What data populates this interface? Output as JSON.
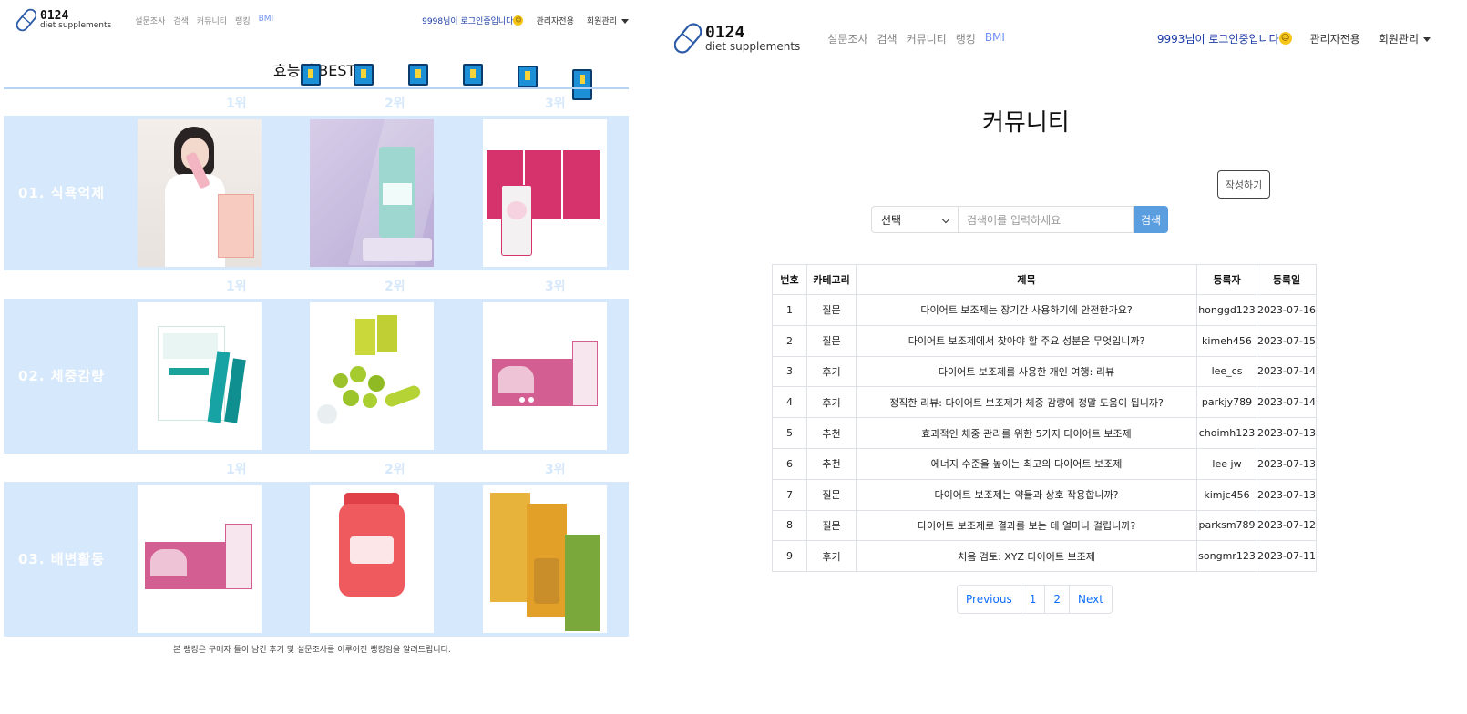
{
  "left": {
    "logo": {
      "number": "0124",
      "subtitle": "diet supplements"
    },
    "nav_links": [
      "설문조사",
      "검색",
      "커뮤니티",
      "랭킹",
      "BMI"
    ],
    "greeting": "9998님이 로그인중입니다",
    "admin_button": "관리자전용",
    "member_menu": "회원관리",
    "ranking_title": "효능별 BEST 3",
    "rank_labels": [
      "1위",
      "2위",
      "3위"
    ],
    "categories": [
      "01. 식욕억제",
      "02. 체중감량",
      "03. 배변활동"
    ],
    "footnote": "본 랭킹은 구매자 들이 남긴 후기 및 설문조사를 이루어진 랭킹임을 알려드립니다."
  },
  "right": {
    "logo": {
      "number": "0124",
      "subtitle": "diet supplements"
    },
    "nav_links": [
      "설문조사",
      "검색",
      "커뮤니티",
      "랭킹",
      "BMI"
    ],
    "greeting": "9993님이 로그인중입니다",
    "admin_button": "관리자전용",
    "member_menu": "회원관리",
    "page_title": "커뮤니티",
    "write_button": "작성하기",
    "select_value": "선택",
    "search_placeholder": "검색어를 입력하세요",
    "search_button": "검색",
    "table": {
      "headers": [
        "번호",
        "카테고리",
        "제목",
        "등록자",
        "등록일"
      ],
      "rows": [
        [
          "1",
          "질문",
          "다이어트 보조제는 장기간 사용하기에 안전한가요?",
          "honggd123",
          "2023-07-16"
        ],
        [
          "2",
          "질문",
          "다이어트 보조제에서 찾아야 할 주요 성분은 무엇입니까?",
          "kimeh456",
          "2023-07-15"
        ],
        [
          "3",
          "후기",
          "다이어트 보조제를 사용한 개인 여행: 리뷰",
          "lee_cs",
          "2023-07-14"
        ],
        [
          "4",
          "후기",
          "정직한 리뷰: 다이어트 보조제가 체중 감량에 정말 도움이 됩니까?",
          "parkjy789",
          "2023-07-14"
        ],
        [
          "5",
          "추천",
          "효과적인 체중 관리를 위한 5가지 다이어트 보조제",
          "choimh123",
          "2023-07-13"
        ],
        [
          "6",
          "추천",
          "에너지 수준을 높이는 최고의 다이어트 보조제",
          "lee jw",
          "2023-07-13"
        ],
        [
          "7",
          "질문",
          "다이어트 보조제는 약물과 상호 작용합니까?",
          "kimjc456",
          "2023-07-13"
        ],
        [
          "8",
          "질문",
          "다이어트 보조제로 결과를 보는 데 얼마나 걸립니까?",
          "parksm789",
          "2023-07-12"
        ],
        [
          "9",
          "후기",
          "처음 검토: XYZ 다이어트 보조제",
          "songmr123",
          "2023-07-11"
        ]
      ]
    },
    "pagination": [
      "Previous",
      "1",
      "2",
      "Next"
    ]
  },
  "colors": {
    "band": "#d6e8fb",
    "accent_blue": "#5b9ee0",
    "link_blue": "#0d6efd",
    "bmi": "#6f8ff2"
  },
  "icons": [
    "pill-capsule-icon",
    "smile-emoji-icon",
    "caret-down-icon",
    "chevron-down-icon",
    "supplement-box-icon"
  ]
}
